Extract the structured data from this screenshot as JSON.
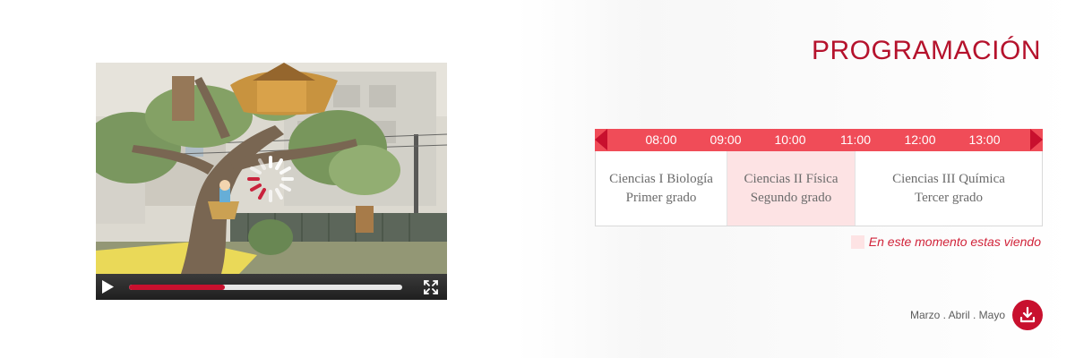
{
  "video": {
    "progress": 0.35,
    "loading": true
  },
  "schedule": {
    "title": "PROGRAMACIÓN",
    "times": [
      "08:00",
      "09:00",
      "10:00",
      "11:00",
      "12:00",
      "13:00"
    ],
    "programs": [
      {
        "name": "Ciencias I Biología",
        "grade": "Primer grado",
        "current": false
      },
      {
        "name": "Ciencias II Física",
        "grade": "Segundo grado",
        "current": true
      },
      {
        "name": "Ciencias III Química",
        "grade": "Tercer grado",
        "current": false
      }
    ],
    "legend": "En este momento estas viendo",
    "download_label": "Marzo . Abril . Mayo"
  },
  "colors": {
    "accent": "#c8102e",
    "time_bar": "#f04c58",
    "highlight": "#fde3e4"
  },
  "icons": {
    "play": "play-icon",
    "fullscreen": "fullscreen-icon",
    "download": "download-icon",
    "prev": "chevron-left-icon",
    "next": "chevron-right-icon",
    "loading": "loading-spinner-icon"
  }
}
